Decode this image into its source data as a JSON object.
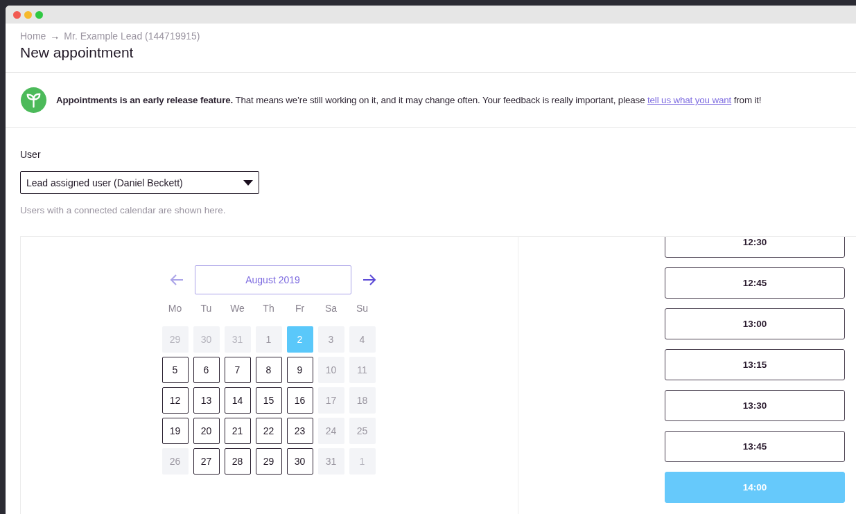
{
  "breadcrumb": [
    {
      "label": "Home"
    },
    {
      "label": "Mr. Example Lead (144719915)"
    }
  ],
  "breadcrumb_separator": "→",
  "title": "New appointment",
  "notice": {
    "text": "**Appointments is an early release feature.** That means we’re still working on it, and it may change often. Your feedback is really important, please ",
    "link": "tell us what you want",
    "after": " from it!"
  },
  "user_field": {
    "label": "User",
    "value": "Lead assigned user (Daniel Beckett)",
    "help": "Users with a connected calendar are shown here."
  },
  "calendar": {
    "month": "August 2019",
    "weekdays": [
      "Mo",
      "Tu",
      "We",
      "Th",
      "Fr",
      "Sa",
      "Su"
    ],
    "days": [
      {
        "label": "29",
        "kind": "outside",
        "selected": false
      },
      {
        "label": "30",
        "kind": "outside",
        "selected": false
      },
      {
        "label": "31",
        "kind": "outside",
        "selected": false
      },
      {
        "label": "1",
        "kind": "unavailable",
        "selected": false
      },
      {
        "label": "2",
        "kind": "available",
        "selected": true
      },
      {
        "label": "3",
        "kind": "unavailable",
        "selected": false
      },
      {
        "label": "4",
        "kind": "unavailable",
        "selected": false
      },
      {
        "label": "5",
        "kind": "available",
        "selected": false
      },
      {
        "label": "6",
        "kind": "available",
        "selected": false
      },
      {
        "label": "7",
        "kind": "available",
        "selected": false
      },
      {
        "label": "8",
        "kind": "available",
        "selected": false
      },
      {
        "label": "9",
        "kind": "available",
        "selected": false
      },
      {
        "label": "10",
        "kind": "unavailable",
        "selected": false
      },
      {
        "label": "11",
        "kind": "unavailable",
        "selected": false
      },
      {
        "label": "12",
        "kind": "available",
        "selected": false
      },
      {
        "label": "13",
        "kind": "available",
        "selected": false
      },
      {
        "label": "14",
        "kind": "available",
        "selected": false
      },
      {
        "label": "15",
        "kind": "available",
        "selected": false
      },
      {
        "label": "16",
        "kind": "available",
        "selected": false
      },
      {
        "label": "17",
        "kind": "unavailable",
        "selected": false
      },
      {
        "label": "18",
        "kind": "unavailable",
        "selected": false
      },
      {
        "label": "19",
        "kind": "available",
        "selected": false
      },
      {
        "label": "20",
        "kind": "available",
        "selected": false
      },
      {
        "label": "21",
        "kind": "available",
        "selected": false
      },
      {
        "label": "22",
        "kind": "available",
        "selected": false
      },
      {
        "label": "23",
        "kind": "available",
        "selected": false
      },
      {
        "label": "24",
        "kind": "unavailable",
        "selected": false
      },
      {
        "label": "25",
        "kind": "unavailable",
        "selected": false
      },
      {
        "label": "26",
        "kind": "unavailable",
        "selected": false
      },
      {
        "label": "27",
        "kind": "available",
        "selected": false
      },
      {
        "label": "28",
        "kind": "available",
        "selected": false
      },
      {
        "label": "29",
        "kind": "available",
        "selected": false
      },
      {
        "label": "30",
        "kind": "available",
        "selected": false
      },
      {
        "label": "31",
        "kind": "unavailable",
        "selected": false
      },
      {
        "label": "1",
        "kind": "outside",
        "selected": false
      }
    ]
  },
  "time_slots": [
    {
      "label": "12:30",
      "selected": false
    },
    {
      "label": "12:45",
      "selected": false
    },
    {
      "label": "13:00",
      "selected": false
    },
    {
      "label": "13:15",
      "selected": false
    },
    {
      "label": "13:30",
      "selected": false
    },
    {
      "label": "13:45",
      "selected": false
    },
    {
      "label": "14:00",
      "selected": true
    }
  ]
}
